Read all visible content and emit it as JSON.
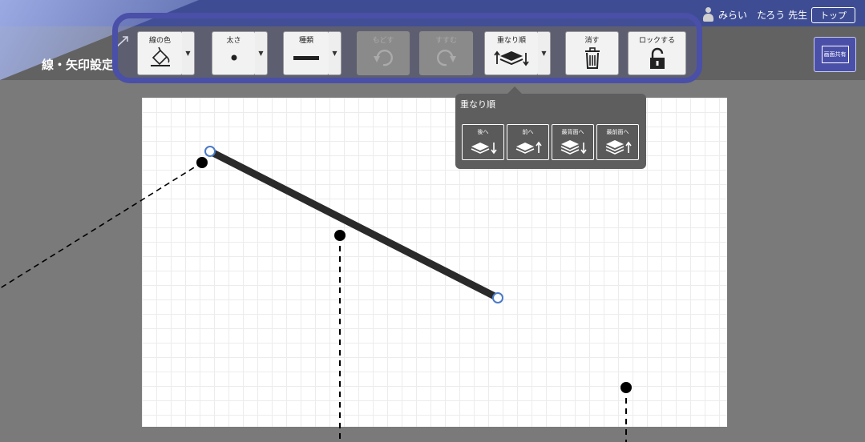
{
  "header": {
    "user_name": "みらい　たろう 先生",
    "top_button": "トップ",
    "title": "線・矢印設定"
  },
  "toolbar": {
    "line_color": "線の色",
    "thickness": "太さ",
    "type": "種類",
    "undo": "もどす",
    "redo": "すすむ",
    "order": "重なり順",
    "delete": "消す",
    "lock": "ロックする"
  },
  "share_button": {
    "label": "画面共有"
  },
  "order_popup": {
    "title": "重なり順",
    "back": "後へ",
    "front": "前へ",
    "to_back": "最背面へ",
    "to_front": "最前面へ"
  },
  "colors": {
    "accent": "#4a4fa8",
    "header_strip": "#3e4d93",
    "line": "#2a2a2a",
    "handle": "#4a7ac8"
  }
}
